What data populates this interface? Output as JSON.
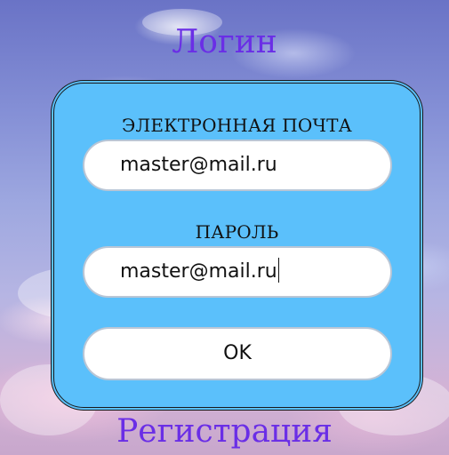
{
  "screen": {
    "title": "Логин",
    "register_link": "Регистрация"
  },
  "form": {
    "email_label": "ЭЛЕКТРОННАЯ ПОЧТА",
    "email_value": "master@mail.ru",
    "password_label": "ПАРОЛЬ",
    "password_value": "master@mail.ru",
    "ok_label": "OK"
  },
  "colors": {
    "title": "#6a2ee6",
    "panel": "#5bc0fb",
    "field_bg": "#ffffff",
    "field_border": "#b9c6d6"
  }
}
